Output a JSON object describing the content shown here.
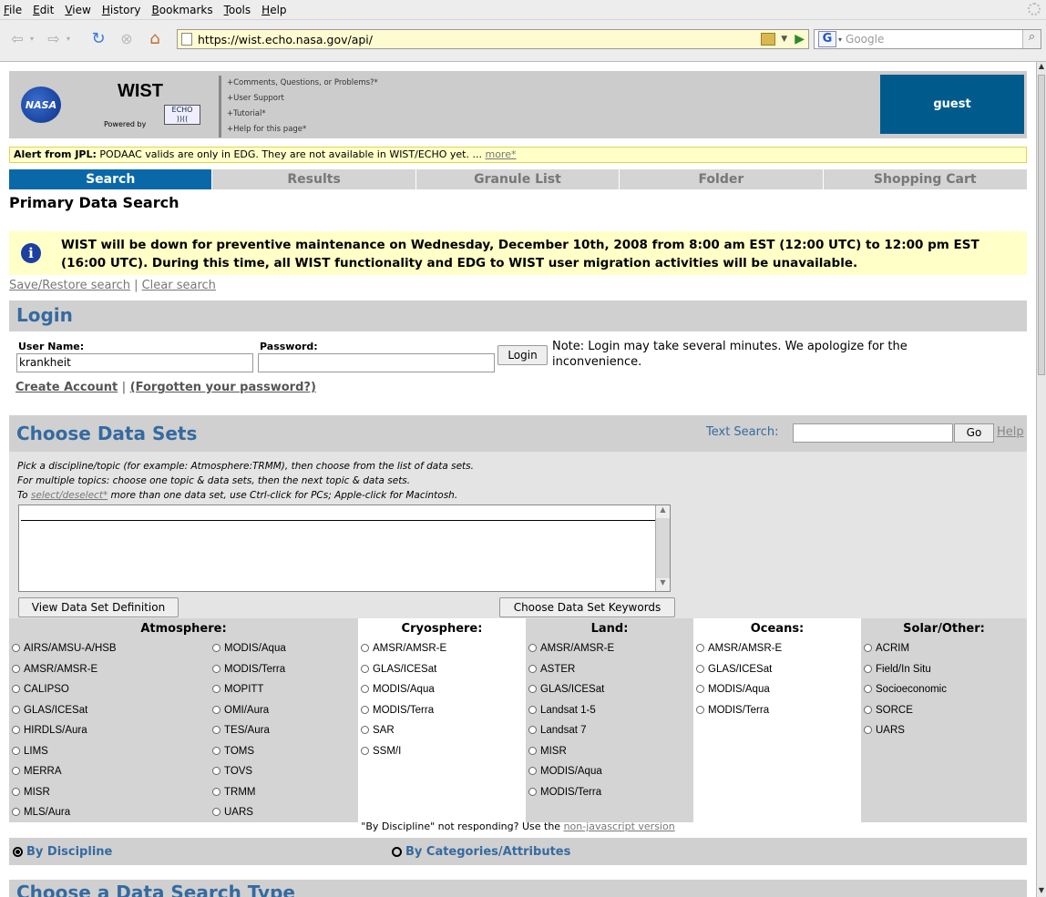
{
  "menu": [
    "File",
    "Edit",
    "View",
    "History",
    "Bookmarks",
    "Tools",
    "Help"
  ],
  "url": "https://wist.echo.nasa.gov/api/",
  "search_placeholder": "Google",
  "header": {
    "logo_text": "NASA",
    "app_name": "WIST",
    "powered_by": "Powered by",
    "echo_label": "ECHO",
    "links": [
      "+Comments, Questions, or Problems?*",
      "+User Support",
      "+Tutorial*",
      "+Help for this page*"
    ],
    "user": "guest"
  },
  "alert": {
    "label": "Alert from JPL:",
    "text": "PODAAC valids are only in EDG. They are not available in WIST/ECHO yet. ...",
    "more": "more*"
  },
  "tabs": [
    "Search",
    "Results",
    "Granule List",
    "Folder",
    "Shopping Cart"
  ],
  "page_title": "Primary Data Search",
  "maintenance": "WIST will be down for preventive maintenance on Wednesday, December 10th, 2008 from 8:00 am EST (12:00 UTC) to 12:00 pm EST (16:00 UTC). During this time, all WIST functionality and EDG to WIST user migration activities will be unavailable.",
  "save_restore": "Save/Restore search",
  "separator": "|",
  "clear_search": "Clear search",
  "login": {
    "title": "Login",
    "user_label": "User Name:",
    "user_value": "krankheit",
    "pass_label": "Password:",
    "button": "Login",
    "note": "Note: Login may take several minutes. We apologize for the inconvenience.",
    "create": "Create Account",
    "forgot": "(Forgotten your password?)"
  },
  "datasets": {
    "title": "Choose Data Sets",
    "text_search_label": "Text Search:",
    "go": "Go",
    "help": "Help",
    "instr1": "Pick a discipline/topic (for example: Atmosphere:TRMM), then choose from the list of data sets.",
    "instr2": "For multiple topics: choose one topic & data sets, then the next topic & data sets.",
    "instr3a": "To",
    "instr3link": "select/deselect*",
    "instr3b": "more than one data set, use Ctrl-click for PCs; Apple-click for Macintosh.",
    "view_def": "View Data Set Definition",
    "keywords": "Choose Data Set Keywords",
    "no_js_text": "\"By Discipline\" not responding? Use the",
    "no_js_link": "non-javascript version",
    "by_discipline": "By Discipline",
    "by_categories": "By Categories/Attributes",
    "next_section": "Choose a Data Search Type"
  },
  "disciplines": {
    "atmosphere": {
      "name": "Atmosphere:",
      "col1": [
        "AIRS/AMSU-A/HSB",
        "AMSR/AMSR-E",
        "CALIPSO",
        "GLAS/ICESat",
        "HIRDLS/Aura",
        "LIMS",
        "MERRA",
        "MISR",
        "MLS/Aura"
      ],
      "col2": [
        "MODIS/Aqua",
        "MODIS/Terra",
        "MOPITT",
        "OMI/Aura",
        "TES/Aura",
        "TOMS",
        "TOVS",
        "TRMM",
        "UARS"
      ]
    },
    "cryosphere": {
      "name": "Cryosphere:",
      "items": [
        "AMSR/AMSR-E",
        "GLAS/ICESat",
        "MODIS/Aqua",
        "MODIS/Terra",
        "SAR",
        "SSM/I"
      ]
    },
    "land": {
      "name": "Land:",
      "items": [
        "AMSR/AMSR-E",
        "ASTER",
        "GLAS/ICESat",
        "Landsat 1-5",
        "Landsat 7",
        "MISR",
        "MODIS/Aqua",
        "MODIS/Terra"
      ]
    },
    "oceans": {
      "name": "Oceans:",
      "items": [
        "AMSR/AMSR-E",
        "GLAS/ICESat",
        "MODIS/Aqua",
        "MODIS/Terra"
      ]
    },
    "solar": {
      "name": "Solar/Other:",
      "items": [
        "ACRIM",
        "Field/In Situ",
        "Socioeconomic",
        "SORCE",
        "UARS"
      ]
    }
  },
  "colors": {
    "accent": "#0b68a8",
    "heading": "#356aa0",
    "alert_bg": "#ffffc8",
    "user_box": "#005b8c"
  }
}
